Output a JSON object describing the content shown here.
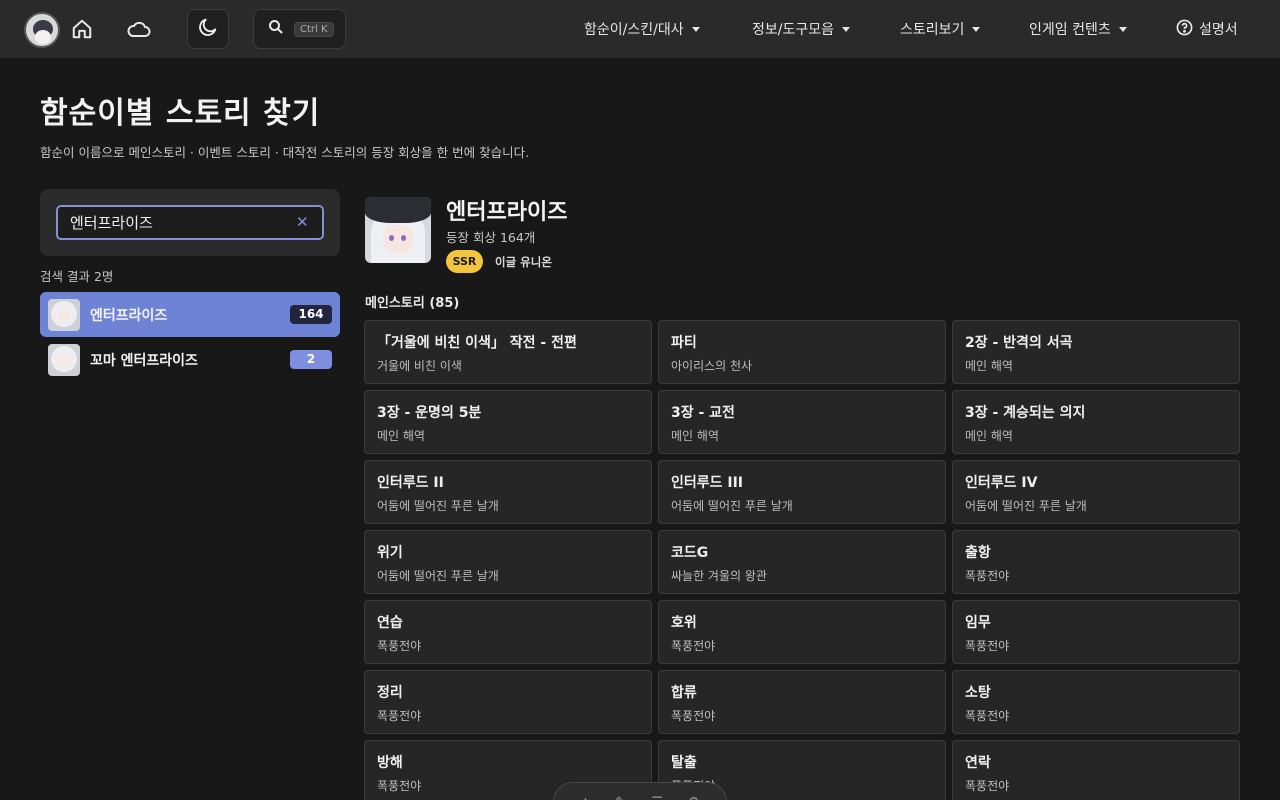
{
  "nav": {
    "search_shortcut": "Ctrl K",
    "menu": [
      {
        "label": "함순이/스킨/대사"
      },
      {
        "label": "정보/도구모음"
      },
      {
        "label": "스토리보기"
      },
      {
        "label": "인게임 컨텐츠"
      }
    ],
    "help_label": "설명서"
  },
  "page": {
    "title": "함순이별 스토리 찾기",
    "subtitle": "함순이 이름으로 메인스토리 · 이벤트 스토리 · 대작전 스토리의 등장 회상을 한 번에 찾습니다."
  },
  "search": {
    "value": "엔터프라이즈",
    "result_count": "검색 결과 2명",
    "results": [
      {
        "name": "엔터프라이즈",
        "count": "164"
      },
      {
        "name": "꼬마 엔터프라이즈",
        "count": "2"
      }
    ]
  },
  "character": {
    "name": "엔터프라이즈",
    "appearances": "등장 회상 164개",
    "rarity": "SSR",
    "faction": "이글 유니온"
  },
  "section": {
    "title": "메인스토리 (85)"
  },
  "stories": [
    {
      "title": "「거울에 비친 이색」 작전 - 전편",
      "sub": "거울에 비친 이색"
    },
    {
      "title": "파티",
      "sub": "아이리스의 천사"
    },
    {
      "title": "2장 - 반격의 서곡",
      "sub": "메인 해역"
    },
    {
      "title": "3장 - 운명의 5분",
      "sub": "메인 해역"
    },
    {
      "title": "3장 - 교전",
      "sub": "메인 해역"
    },
    {
      "title": "3장 - 계승되는 의지",
      "sub": "메인 해역"
    },
    {
      "title": "인터루드 II",
      "sub": "어둠에 떨어진 푸른 날개"
    },
    {
      "title": "인터루드 III",
      "sub": "어둠에 떨어진 푸른 날개"
    },
    {
      "title": "인터루드 IV",
      "sub": "어둠에 떨어진 푸른 날개"
    },
    {
      "title": "위기",
      "sub": "어둠에 떨어진 푸른 날개"
    },
    {
      "title": "코드G",
      "sub": "싸늘한 겨울의 왕관"
    },
    {
      "title": "출항",
      "sub": "폭풍전야"
    },
    {
      "title": "연습",
      "sub": "폭풍전야"
    },
    {
      "title": "호위",
      "sub": "폭풍전야"
    },
    {
      "title": "임무",
      "sub": "폭풍전야"
    },
    {
      "title": "정리",
      "sub": "폭풍전야"
    },
    {
      "title": "합류",
      "sub": "폭풍전야"
    },
    {
      "title": "소탕",
      "sub": "폭풍전야"
    },
    {
      "title": "방해",
      "sub": "폭풍전야"
    },
    {
      "title": "탈출",
      "sub": "폭풍전야"
    },
    {
      "title": "연락",
      "sub": "폭풍전야"
    }
  ],
  "colors": {
    "accent": "#6f83d6",
    "rarity_ssr": "#f2c53d",
    "card_bg": "#262626",
    "page_bg": "#181818"
  }
}
